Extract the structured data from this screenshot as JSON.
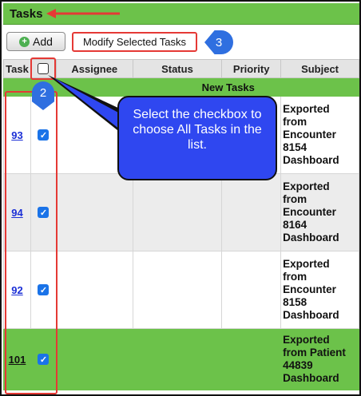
{
  "window": {
    "title": "Tasks"
  },
  "toolbar": {
    "add_label": "Add",
    "modify_label": "Modify Selected Tasks",
    "callout_number": "3"
  },
  "table": {
    "headers": {
      "task": "Task",
      "assignee": "Assignee",
      "status": "Status",
      "priority": "Priority",
      "subject": "Subject"
    },
    "group_label": "New Tasks",
    "rows": [
      {
        "task": "93",
        "subject_lines": [
          "Exported",
          "from",
          "Encounter",
          "8154",
          "Dashboard"
        ],
        "checked": true
      },
      {
        "task": "94",
        "subject_lines": [
          "Exported",
          "from",
          "Encounter",
          "8164",
          "Dashboard"
        ],
        "checked": true
      },
      {
        "task": "92",
        "subject_lines": [
          "Exported",
          "from",
          "Encounter",
          "8158",
          "Dashboard"
        ],
        "checked": true
      },
      {
        "task": "101",
        "subject_lines": [
          "Exported",
          "from Patient",
          "44839",
          "Dashboard"
        ],
        "checked": true
      }
    ]
  },
  "annotations": {
    "step2_number": "2",
    "bubble_text": "Select the checkbox to choose All Tasks in the list."
  },
  "colors": {
    "green": "#6cc24a",
    "callout_blue": "#2f6fe0",
    "highlight_red": "#e53935"
  }
}
